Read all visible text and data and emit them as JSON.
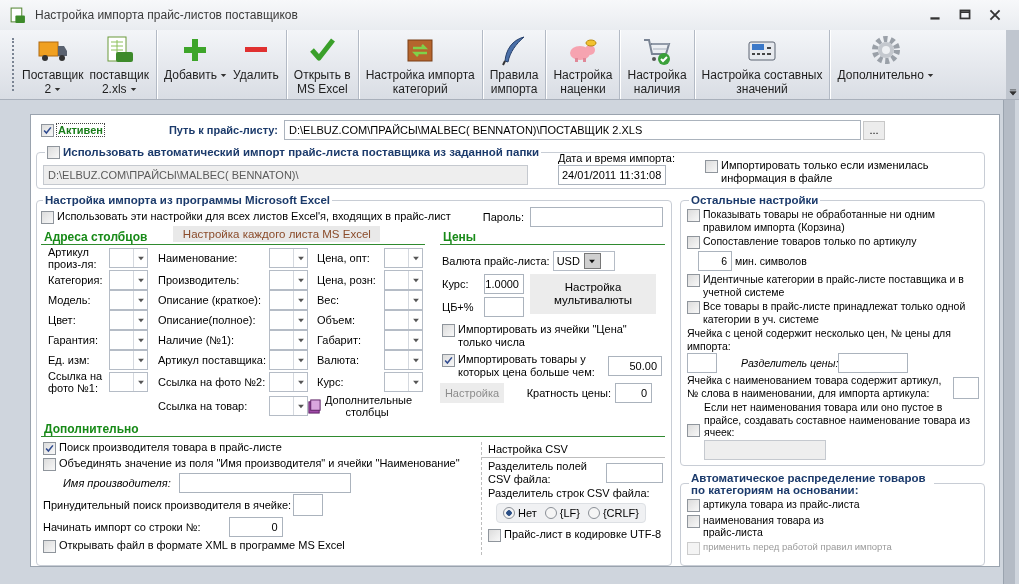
{
  "window": {
    "title": "Настройка импорта прайс-листов поставщиков"
  },
  "toolbar": [
    {
      "kind": "truck",
      "label": "Поставщик\n2",
      "dropdown": true,
      "separator_before": false
    },
    {
      "kind": "spreadsheet",
      "label": "поставщик\n2.xls",
      "dropdown": true,
      "separator_before": false
    },
    {
      "kind": "plus",
      "label": "Добавить",
      "dropdown": true,
      "separator_before": true
    },
    {
      "kind": "minus",
      "label": "Удалить",
      "dropdown": false,
      "separator_before": false
    },
    {
      "kind": "check",
      "label": "Открыть в\nMS Excel",
      "dropdown": false,
      "separator_before": true
    },
    {
      "kind": "box",
      "label": "Настройка импорта\nкатегорий",
      "dropdown": false,
      "separator_before": true
    },
    {
      "kind": "feather",
      "label": "Правила\nимпорта",
      "dropdown": false,
      "separator_before": true
    },
    {
      "kind": "pig",
      "label": "Настройка\nнаценки",
      "dropdown": false,
      "separator_before": true
    },
    {
      "kind": "cart",
      "label": "Настройка\nналичия",
      "dropdown": false,
      "separator_before": true
    },
    {
      "kind": "calculator",
      "label": "Настройка составных\nзначений",
      "dropdown": false,
      "separator_before": true
    },
    {
      "kind": "gear",
      "label": "Дополнительно",
      "dropdown": true,
      "separator_before": true
    }
  ],
  "active": {
    "label": "Активен",
    "checked": true
  },
  "path": {
    "label": "Путь к прайс-листу:",
    "value": "D:\\ELBUZ.COM\\ПРАЙСЫ\\MALBEC( BENNATON)\\ПОСТАВЩИК 2.XLS",
    "browse": "..."
  },
  "auto_import": {
    "label": "Использовать автоматический импорт прайс-листа поставщика из заданной папки",
    "checked": false,
    "folder": "D:\\ELBUZ.COM\\ПРАЙСЫ\\MALBEC( BENNATON)\\",
    "folder_disabled": true,
    "date_label": "Дата и время импорта:",
    "date_value": "24/01/2011 11:31:08",
    "only_changed": {
      "label": "Импортировать только если изменилась информация в файле",
      "checked": false
    }
  },
  "excel": {
    "title": "Настройка импорта из программы Microsoft Excel",
    "all_sheets": {
      "label": "Использовать эти настройки для всех листов Excel'я, входящих в прайс-лист",
      "checked": false
    },
    "password_label": "Пароль:",
    "per_sheet_button": "Настройка каждого листа MS Excel",
    "columns_title": "Адреса столбцов",
    "columns": [
      [
        {
          "label": "Артикул произ-ля:"
        },
        {
          "label": "Категория:"
        },
        {
          "label": "Модель:"
        },
        {
          "label": "Цвет:"
        },
        {
          "label": "Гарантия:"
        },
        {
          "label": "Ед. изм:"
        },
        {
          "label": "Ссылка на фото №1:"
        }
      ],
      [
        {
          "label": "Наименование:"
        },
        {
          "label": "Производитель:"
        },
        {
          "label": "Описание (краткое):"
        },
        {
          "label": "Описание(полное):"
        },
        {
          "label": "Наличие (№1):"
        },
        {
          "label": "Артикул поставщика:"
        },
        {
          "label": "Ссылка на фото №2:"
        },
        {
          "label": "Ссылка на товар:"
        }
      ],
      [
        {
          "label": "Цена, опт:"
        },
        {
          "label": "Цена, розн:"
        },
        {
          "label": "Вес:"
        },
        {
          "label": "Объем:"
        },
        {
          "label": "Габарит:"
        },
        {
          "label": "Валюта:"
        },
        {
          "label": "Курс:"
        }
      ]
    ],
    "extra_columns_button": "Дополнительные столбцы",
    "prices": {
      "title": "Цены",
      "currency_label": "Валюта прайс-листа:",
      "currency": "USD",
      "rate_label": "Курс:",
      "rate": "1.0000",
      "cb_label": "ЦБ+%",
      "multicurrency_button": "Настройка мультивалюты",
      "numbers_only": {
        "label": "Импортировать из ячейки \"Цена\" только числа",
        "checked": false
      },
      "min_price": {
        "label": "Импортировать товары у которых цена больше чем:",
        "checked": true,
        "value": "50.00"
      },
      "settings_button": {
        "label": "Настройка",
        "disabled": true
      },
      "multiplicity_label": "Кратность цены:",
      "multiplicity": "0"
    },
    "extra": {
      "title": "Дополнительно",
      "search_maker": {
        "label": "Поиск производителя товара в прайс-листе",
        "checked": true
      },
      "merge_name": {
        "label": "Объединять значение из поля \"Имя производителя\" и ячейки \"Наименование\"",
        "checked": false
      },
      "maker_name_label": "Имя производителя:",
      "forced_search_label": "Принудительный поиск производителя в ячейке:",
      "start_row_label": "Начинать импорт со строки №:",
      "start_row": "0",
      "open_xml": {
        "label": "Открывать файл в формате XML в программе MS Excel",
        "checked": false
      }
    },
    "csv": {
      "title": "Настройка CSV",
      "field_sep_label": "Разделитель полей CSV файла:",
      "row_sep_label": "Разделитель строк CSV файла:",
      "row_sep": [
        {
          "label": "Нет",
          "selected": true
        },
        {
          "label": "{LF}",
          "selected": false
        },
        {
          "label": "{CRLF}",
          "selected": false
        }
      ],
      "utf8": {
        "label": "Прайс-лист в кодировке UTF-8",
        "checked": false
      }
    }
  },
  "other": {
    "title": "Остальные настройки",
    "show_basket": {
      "label": "Показывать товары не обработанные ни одним правилом импорта (Корзина)",
      "checked": false
    },
    "match_by_sku": {
      "label": "Сопоставление товаров только по артикулу",
      "checked": false,
      "min_value": "6",
      "min_label": "мин. символов"
    },
    "same_categories": {
      "label": "Идентичные категории в прайс-листе поставщика и в учетной системе",
      "checked": false
    },
    "one_category": {
      "label": "Все товары в прайс-листе принадлежат только одной категории в уч. системе",
      "checked": false
    },
    "multi_price_label": "Ячейка с ценой содержит несколько цен, № цены для импорта:",
    "price_sep_label": "Разделитель цены:",
    "sku_in_name_label": "Ячейка с наименованием товара содержит артикул, № слова в наименовании, для импорта артикула:",
    "compose_name": {
      "label": "Если нет наименования товара или оно пустое в прайсе, создавать составное наименование товара из ячеек:",
      "checked": false
    }
  },
  "auto_distribution": {
    "title": "Автоматическое распределение товаров по категориям на основании:",
    "by_sku": {
      "label": "артикула товара из прайс-листа",
      "checked": false
    },
    "by_name": {
      "label": "наименования товара из прайс-листа",
      "checked": false
    },
    "apply_rules": {
      "label": "применить перед работой правил импорта",
      "checked": false,
      "disabled": true
    }
  }
}
